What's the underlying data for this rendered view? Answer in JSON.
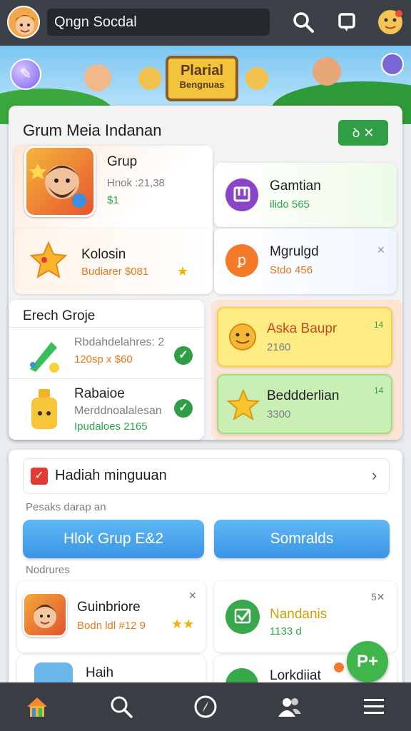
{
  "topbar": {
    "search_text": "Qngn Socdal"
  },
  "banner": {
    "sign_line1": "Plarial",
    "sign_line2": "Bengnuas"
  },
  "group_panel": {
    "title": "Grum Meia Indanan",
    "toggle_label": "ꝺ ✕",
    "group_card": {
      "name": "Grup",
      "stat": "Hnok :21,38",
      "badge": "$1"
    },
    "item_gambtian": {
      "name": "Gamtian",
      "sub": "ilido 565"
    },
    "item_kolosin": {
      "name": "Kolosin",
      "sub": "Budiarer $081"
    },
    "item_mgrulgd": {
      "name": "Mgrulgd",
      "sub": "Stdo 456"
    }
  },
  "erech_card": {
    "title": "Erech Groje",
    "row1": {
      "name": "Rbdahdelahres: 2",
      "sub": "120sp x $60"
    },
    "row2": {
      "name": "Rabaioe",
      "sub1": "Merddnoalalesan",
      "sub2": "Ipudaloes 2165"
    }
  },
  "yellow_card": {
    "name": "Aska Baupr",
    "value": "2160",
    "corner": "14"
  },
  "green_card": {
    "name": "Beddderlian",
    "value": "3300",
    "corner": "14"
  },
  "reward_panel": {
    "title": "Hadiah minguuan",
    "caption1": "Pesaks darap an",
    "button_left": "Hlok Grup E&2",
    "button_right": "Somralds",
    "caption2": "Nodrures",
    "card_a": {
      "name": "Guinbriore",
      "sub": "Bodn ldl #12 9"
    },
    "card_a_corner": "✕",
    "card_b": {
      "name": "Nandanis",
      "sub": "1133 d"
    },
    "card_b_corner": "5✕",
    "card_c": {
      "name": "Haih"
    },
    "card_d": {
      "name": "Lorkdiiat"
    },
    "fab_label": "P+"
  },
  "colors": {
    "topbar": "#3c4047",
    "accent_green": "#2f9e44",
    "accent_blue": "#3a95e6",
    "navbar": "#3a3d43"
  }
}
